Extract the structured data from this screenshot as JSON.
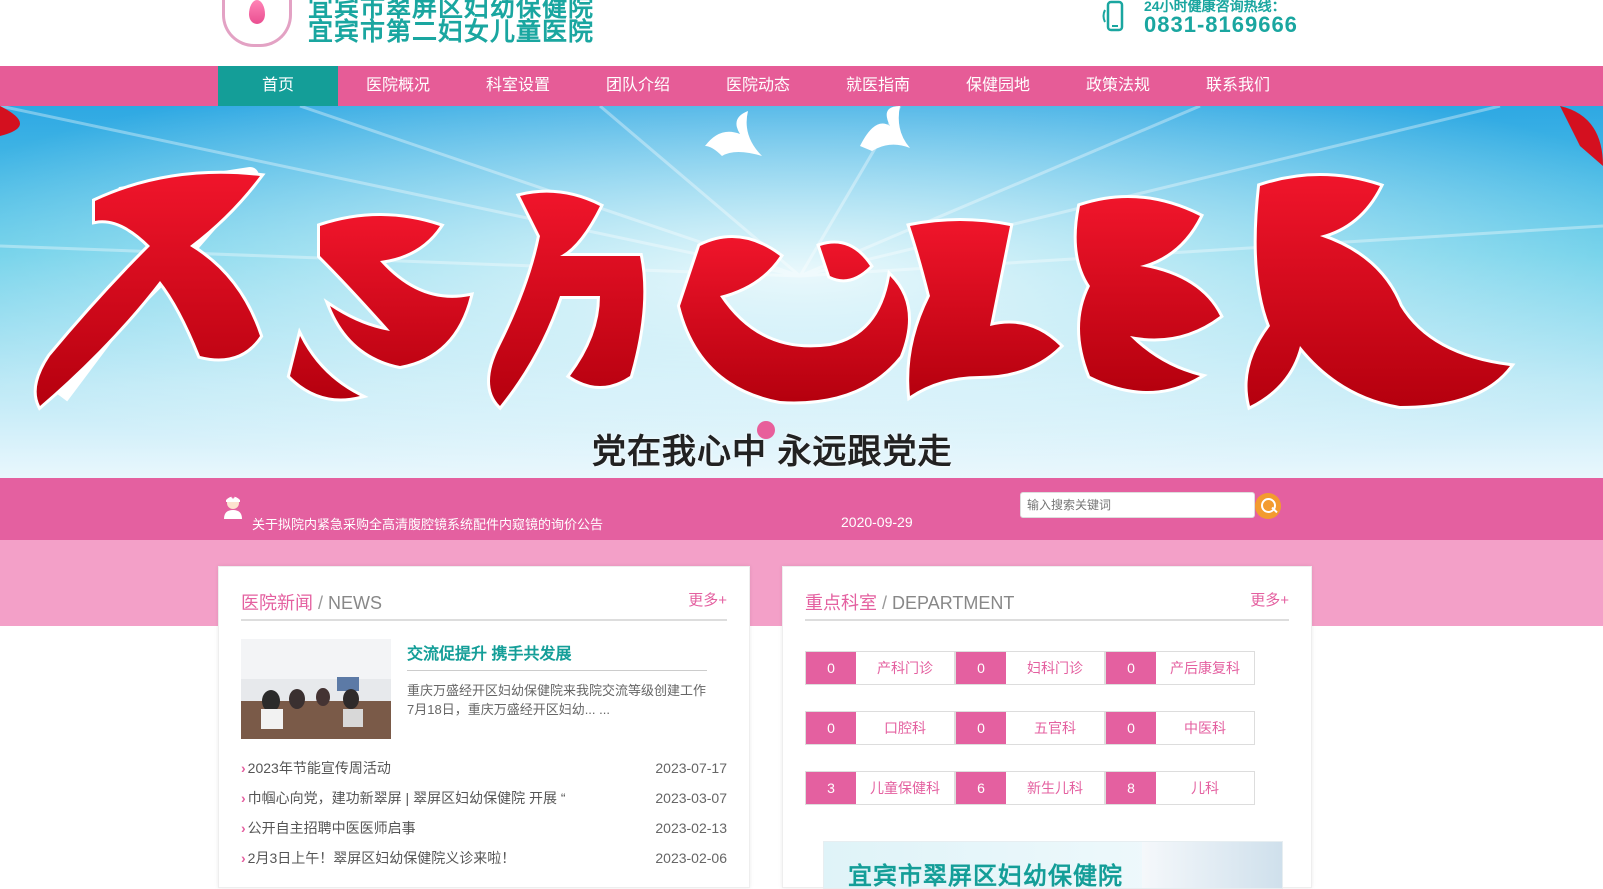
{
  "header": {
    "logo_line1": "宜宾市翠屏区妇幼保健院",
    "logo_line2": "宜宾市第二妇女儿童医院",
    "hotline_label": "24小时健康咨询热线：",
    "hotline_number": "0831-8169666"
  },
  "nav": {
    "items": [
      "首页",
      "医院概况",
      "科室设置",
      "团队介绍",
      "医院动态",
      "就医指南",
      "保健园地",
      "政策法规",
      "联系我们"
    ],
    "active_index": 0
  },
  "banner": {
    "headline": "不忘初心跟党走",
    "subtitle": "党在我心中 永远跟党走"
  },
  "notice": {
    "text": "关于拟院内紧急采购全高清腹腔镜系统配件内窥镜的询价公告",
    "date": "2020-09-29"
  },
  "search": {
    "placeholder": "输入搜索关键词"
  },
  "news": {
    "title_cn": "医院新闻",
    "separator": "/",
    "title_en": "NEWS",
    "more": "更多+",
    "featured": {
      "title": "交流促提升 携手共发展",
      "desc": "重庆万盛经开区妇幼保健院来我院交流等级创建工作7月18日，重庆万盛经开区妇幼... ..."
    },
    "items": [
      {
        "title": "2023年节能宣传周活动",
        "date": "2023-07-17"
      },
      {
        "title": "巾帼心向党，建功新翠屏 | 翠屏区妇幼保健院 开展 “",
        "date": "2023-03-07"
      },
      {
        "title": "公开自主招聘中医医师启事",
        "date": "2023-02-13"
      },
      {
        "title": "2月3日上午！翠屏区妇幼保健院义诊来啦！",
        "date": "2023-02-06"
      }
    ]
  },
  "departments": {
    "title_cn": "重点科室",
    "separator": "/",
    "title_en": "DEPARTMENT",
    "more": "更多+",
    "rows": [
      [
        {
          "count": "0",
          "name": "产科门诊"
        },
        {
          "count": "0",
          "name": "妇科门诊"
        },
        {
          "count": "0",
          "name": "产后康复科"
        }
      ],
      [
        {
          "count": "0",
          "name": "口腔科"
        },
        {
          "count": "0",
          "name": "五官科"
        },
        {
          "count": "0",
          "name": "中医科"
        }
      ],
      [
        {
          "count": "3",
          "name": "儿童保健科"
        },
        {
          "count": "6",
          "name": "新生儿科"
        },
        {
          "count": "8",
          "name": "儿科"
        }
      ]
    ],
    "banner_text": "宜宾市翠屏区妇幼保健院"
  },
  "colors": {
    "brand_pink": "#e65c97",
    "brand_teal": "#149e98",
    "accent_orange": "#f39b2f"
  }
}
